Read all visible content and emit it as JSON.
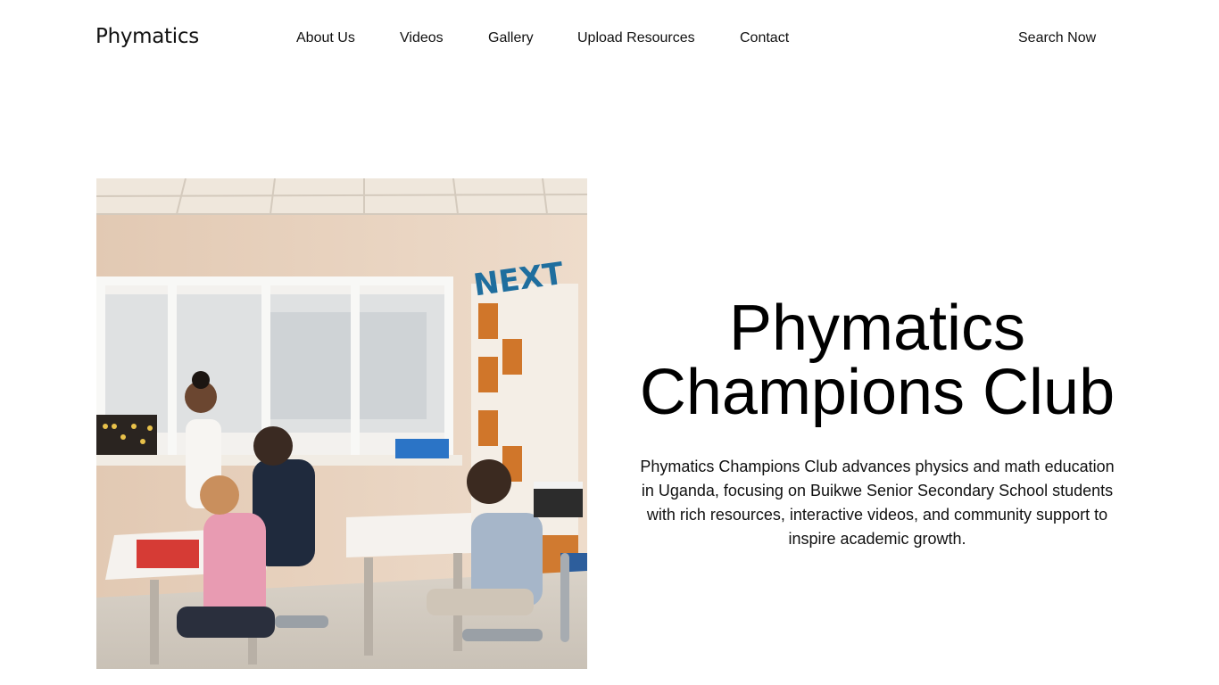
{
  "brand": {
    "name": "Phymatics"
  },
  "nav": {
    "items": [
      {
        "label": "About Us"
      },
      {
        "label": "Videos"
      },
      {
        "label": "Gallery"
      },
      {
        "label": "Upload Resources"
      },
      {
        "label": "Contact"
      }
    ],
    "search_label": "Search Now"
  },
  "hero": {
    "image_subject": "classroom-photo",
    "image_sign_text": "NEXT",
    "title": "Phymatics Champions Club",
    "description": "Phymatics Champions Club advances physics and math education in Uganda, focusing on Buikwe Senior Secondary School students with rich resources, interactive videos, and community support to inspire academic growth."
  }
}
